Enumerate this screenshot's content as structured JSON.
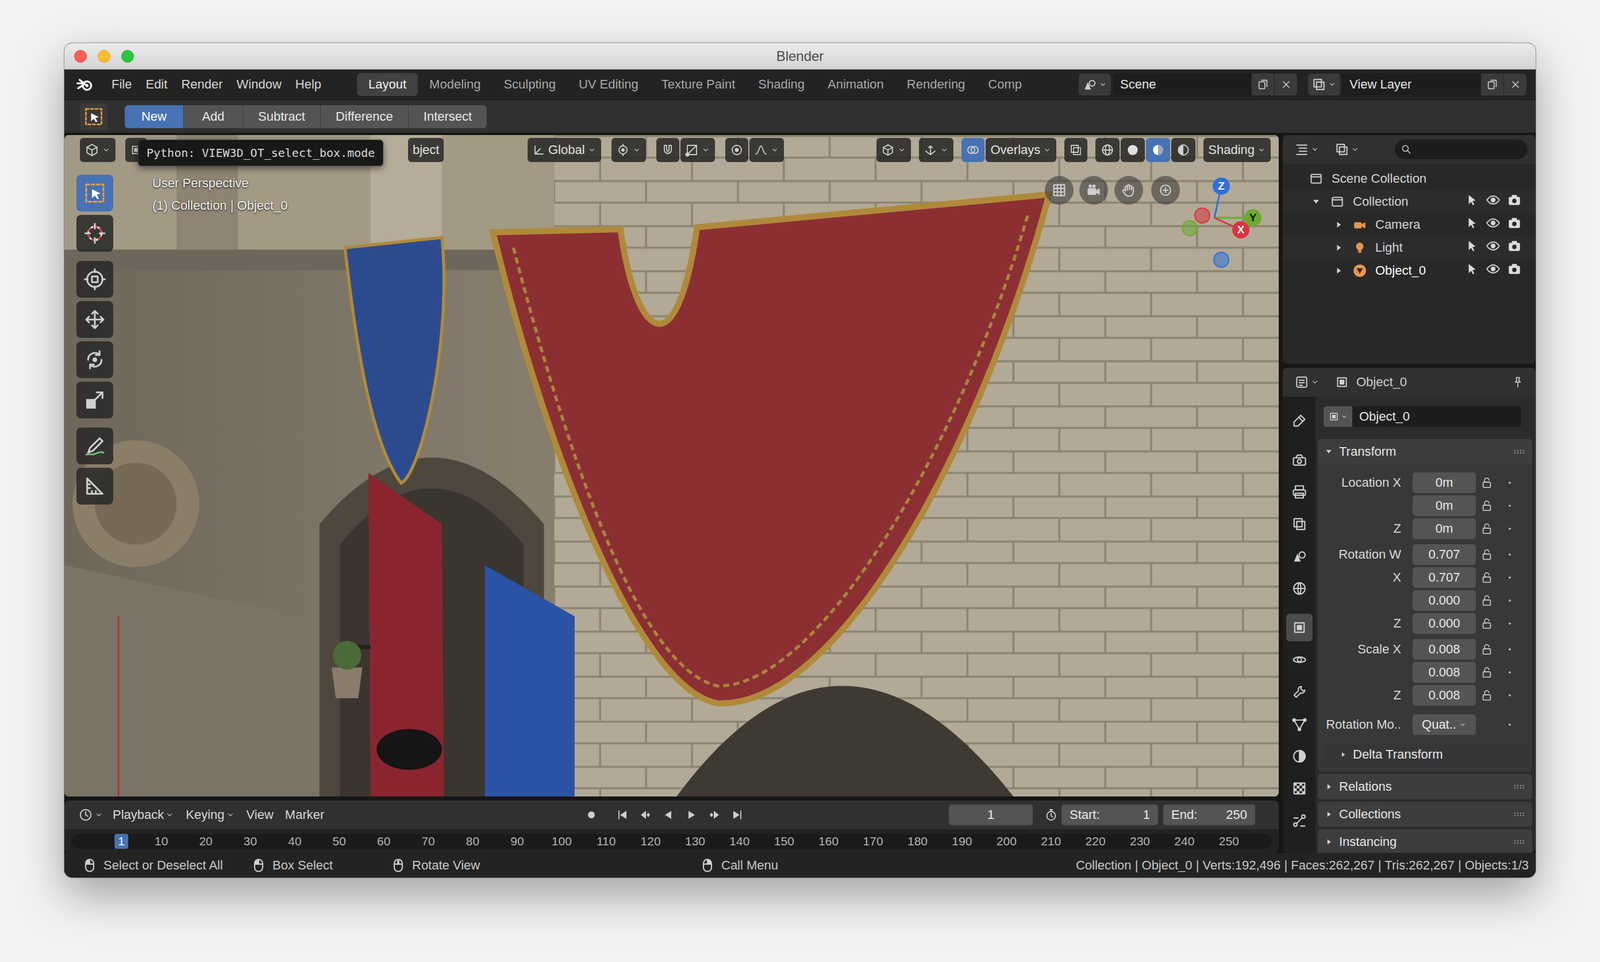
{
  "window": {
    "title": "Blender"
  },
  "menu": [
    "File",
    "Edit",
    "Render",
    "Window",
    "Help"
  ],
  "workspaces": [
    {
      "label": "Layout",
      "selected": true
    },
    {
      "label": "Modeling",
      "selected": false
    },
    {
      "label": "Sculpting",
      "selected": false
    },
    {
      "label": "UV Editing",
      "selected": false
    },
    {
      "label": "Texture Paint",
      "selected": false
    },
    {
      "label": "Shading",
      "selected": false
    },
    {
      "label": "Animation",
      "selected": false
    },
    {
      "label": "Rendering",
      "selected": false
    },
    {
      "label": "Comp",
      "selected": false
    }
  ],
  "scene": "Scene",
  "view_layer": "View Layer",
  "boolean_modes": [
    {
      "label": "New",
      "selected": true
    },
    {
      "label": "Add",
      "selected": false
    },
    {
      "label": "Subtract",
      "selected": false
    },
    {
      "label": "Difference",
      "selected": false
    },
    {
      "label": "Intersect",
      "selected": false
    }
  ],
  "viewport": {
    "tooltip": "Python: VIEW3D_OT_select_box.mode",
    "menu_fragment": "bject",
    "orientation": "Global",
    "overlays": "Overlays",
    "overlays_enabled": true,
    "xray": false,
    "shading": "Shading",
    "shading_modes": [
      {
        "selected": false
      },
      {
        "selected": false
      },
      {
        "selected": true
      },
      {
        "selected": false
      }
    ],
    "view_name": "User Perspective",
    "context": "(1) Collection | Object_0",
    "tools": [
      {
        "selected": true
      },
      {
        "selected": false
      },
      {
        "selected": false
      },
      {
        "selected": false
      },
      {
        "selected": false
      },
      {
        "selected": false
      },
      {
        "selected": false
      },
      {
        "selected": false
      }
    ],
    "gizmo_axes": [
      {
        "label": "Z",
        "color": "#2f6fd8"
      },
      {
        "label": "Y",
        "color": "#6aab2e"
      },
      {
        "label": "X",
        "color": "#d9343f"
      }
    ]
  },
  "outliner": {
    "root": "Scene Collection",
    "items": [
      {
        "label": "Collection",
        "kind": "collection",
        "level": 1,
        "expanded": true,
        "selected": false,
        "visible": true,
        "renderable": true
      },
      {
        "label": "Camera",
        "kind": "camera",
        "level": 2,
        "expanded": false,
        "selected": false,
        "visible": true,
        "renderable": true
      },
      {
        "label": "Light",
        "kind": "light",
        "level": 2,
        "expanded": false,
        "selected": false,
        "visible": true,
        "renderable": true
      },
      {
        "label": "Object_0",
        "kind": "mesh",
        "level": 2,
        "expanded": false,
        "selected": true,
        "visible": true,
        "renderable": true
      }
    ]
  },
  "properties": {
    "header": "Object_0",
    "name": "Object_0",
    "tabs": [
      {
        "selected": false
      },
      {
        "selected": false
      },
      {
        "selected": false
      },
      {
        "selected": false
      },
      {
        "selected": false
      },
      {
        "selected": false
      },
      {
        "selected": true
      },
      {
        "selected": false
      },
      {
        "selected": false
      },
      {
        "selected": false
      },
      {
        "selected": false
      },
      {
        "selected": false
      },
      {
        "selected": false
      }
    ],
    "transform": {
      "title": "Transform",
      "expanded": true,
      "rows": [
        {
          "label": "Location X",
          "value": "0m",
          "locked": false
        },
        {
          "value": "0m",
          "locked": false
        },
        {
          "label": "Z",
          "value": "0m",
          "locked": false
        },
        {
          "label": "Rotation W",
          "value": "0.707",
          "locked": false
        },
        {
          "label": "X",
          "value": "0.707",
          "locked": false
        },
        {
          "value": "0.000",
          "locked": false
        },
        {
          "label": "Z",
          "value": "0.000",
          "locked": false
        },
        {
          "label": "Scale X",
          "value": "0.008",
          "locked": false
        },
        {
          "value": "0.008",
          "locked": false
        },
        {
          "label": "Z",
          "value": "0.008",
          "locked": false
        }
      ],
      "mode": {
        "label": "Rotation Mo..",
        "value": "Quat.."
      },
      "subpanel": {
        "title": "Delta Transform",
        "expanded": false
      }
    },
    "sections": [
      {
        "title": "Relations",
        "expanded": false
      },
      {
        "title": "Collections",
        "expanded": false
      },
      {
        "title": "Instancing",
        "expanded": false
      }
    ]
  },
  "timeline": {
    "menus": [
      {
        "label": "Playback",
        "dropdown": true
      },
      {
        "label": "Keying",
        "dropdown": true
      },
      {
        "label": "View",
        "dropdown": false
      },
      {
        "label": "Marker",
        "dropdown": false
      }
    ],
    "frame": "1",
    "start_label": "Start:",
    "start": "1",
    "end_label": "End:",
    "end": "250",
    "ruler": [
      {
        "label": "1",
        "selected": true
      },
      {
        "label": "10",
        "selected": false
      },
      {
        "label": "20",
        "selected": false
      },
      {
        "label": "30",
        "selected": false
      },
      {
        "label": "40",
        "selected": false
      },
      {
        "label": "50",
        "selected": false
      },
      {
        "label": "60",
        "selected": false
      },
      {
        "label": "70",
        "selected": false
      },
      {
        "label": "80",
        "selected": false
      },
      {
        "label": "90",
        "selected": false
      },
      {
        "label": "100",
        "selected": false
      },
      {
        "label": "110",
        "selected": false
      },
      {
        "label": "120",
        "selected": false
      },
      {
        "label": "130",
        "selected": false
      },
      {
        "label": "140",
        "selected": false
      },
      {
        "label": "150",
        "selected": false
      },
      {
        "label": "160",
        "selected": false
      },
      {
        "label": "170",
        "selected": false
      },
      {
        "label": "180",
        "selected": false
      },
      {
        "label": "190",
        "selected": false
      },
      {
        "label": "200",
        "selected": false
      },
      {
        "label": "210",
        "selected": false
      },
      {
        "label": "220",
        "selected": false
      },
      {
        "label": "230",
        "selected": false
      },
      {
        "label": "240",
        "selected": false
      },
      {
        "label": "250",
        "selected": false
      }
    ]
  },
  "status_bar": {
    "hints": [
      "Select or Deselect All",
      "Box Select",
      "Rotate View",
      "Call Menu"
    ],
    "info": "Collection | Object_0 | Verts:192,496 | Faces:262,267 | Tris:262,267 | Objects:1/3"
  }
}
